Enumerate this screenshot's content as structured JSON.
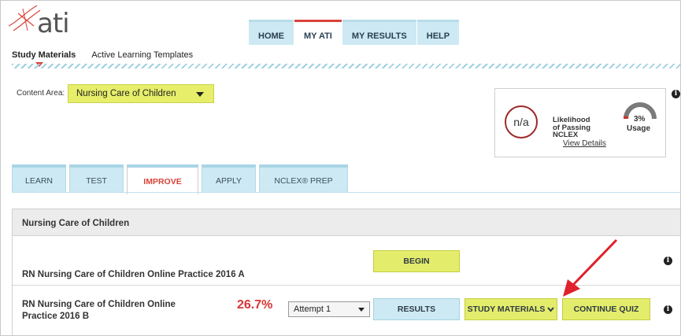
{
  "brand": {
    "logo_text": "ati"
  },
  "topnav": {
    "tabs": [
      {
        "label": "HOME",
        "active": false
      },
      {
        "label": "MY ATI",
        "active": true
      },
      {
        "label": "MY RESULTS",
        "active": false
      },
      {
        "label": "HELP",
        "active": false
      }
    ]
  },
  "subnav": {
    "items": [
      {
        "label": "Study Materials",
        "active": true
      },
      {
        "label": "Active Learning Templates",
        "active": false
      }
    ]
  },
  "content_area": {
    "label": "Content Area:",
    "selected": "Nursing Care of Children"
  },
  "likelihood": {
    "value": "n/a",
    "line1": "Likelihood",
    "line2": "of Passing",
    "line3": "NCLEX",
    "link": "View Details",
    "usage_pct": "3%",
    "usage_label": "Usage",
    "usage_fraction": 0.03
  },
  "section_tabs": [
    {
      "label": "LEARN",
      "active": false
    },
    {
      "label": "TEST",
      "active": false
    },
    {
      "label": "IMPROVE",
      "active": true
    },
    {
      "label": "APPLY",
      "active": false
    },
    {
      "label": "NCLEX® PREP",
      "active": false
    }
  ],
  "panel": {
    "title": "Nursing Care of Children",
    "rows": [
      {
        "title": "RN Nursing Care of Children Online Practice 2016 A",
        "begin_label": "BEGIN"
      },
      {
        "title_line1": "RN Nursing Care of Children Online",
        "title_line2": "Practice 2016 B",
        "score": "26.7%",
        "attempt": "Attempt 1",
        "results_label": "RESULTS",
        "study_label": "STUDY MATERIALS",
        "continue_label": "CONTINUE QUIZ"
      }
    ]
  },
  "colors": {
    "accent_red": "#d9433a",
    "button_green": "#e4ec6c",
    "tab_blue": "#cde9f3",
    "arrow": "#e0202a"
  },
  "icons": {
    "info": "info-icon",
    "dropdown": "chevron-down-icon",
    "arrow": "red-arrow-annotation"
  }
}
